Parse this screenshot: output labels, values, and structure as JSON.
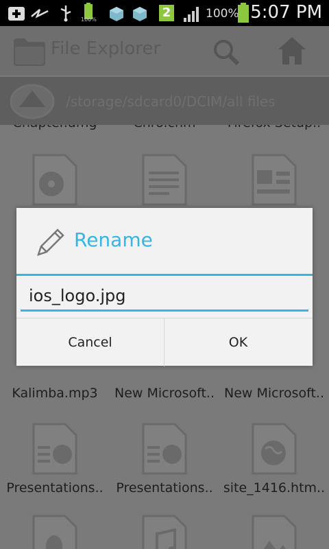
{
  "status_bar": {
    "battery_small_pct": "100%",
    "notification_count": "2",
    "battery_pct": "100%",
    "time": "5:07 PM"
  },
  "app_bar": {
    "title": "File Explorer"
  },
  "path_bar": {
    "path": "/storage/sdcard0/DCIM/all files"
  },
  "files": {
    "row0": [
      "Chapter.dmg",
      "Chro.chm",
      "Firefox Setup.."
    ],
    "row2": [
      "Kalimba.mp3",
      "New Microsoft..",
      "New Microsoft.."
    ],
    "row3": [
      "Presentations..",
      "Presentations..",
      "site_1416.htm.."
    ]
  },
  "dialog": {
    "title": "Rename",
    "input_value": "ios_logo.jpg",
    "cancel_label": "Cancel",
    "ok_label": "OK",
    "accent": "#33b5e5"
  }
}
